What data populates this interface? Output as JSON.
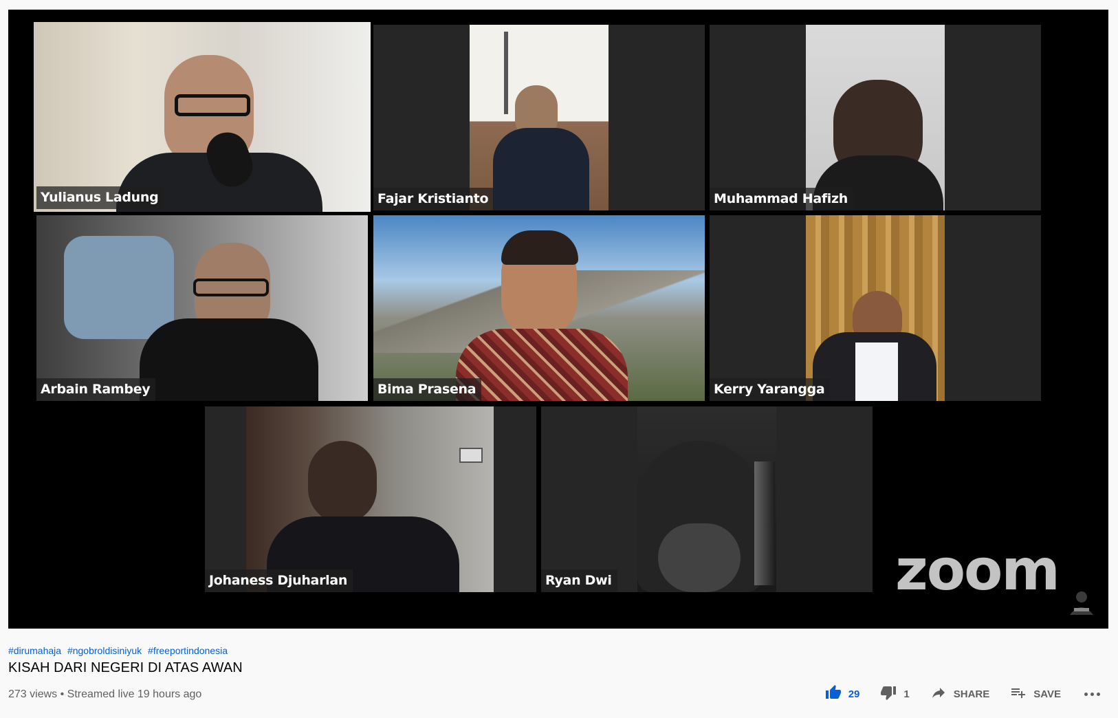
{
  "meeting": {
    "participants": [
      {
        "name": "Yulianus Ladung",
        "active": true
      },
      {
        "name": "Fajar Kristianto",
        "active": false
      },
      {
        "name": "Muhammad Hafizh",
        "active": false
      },
      {
        "name": "Arbain Rambey",
        "active": false
      },
      {
        "name": "Bima Prasena",
        "active": false
      },
      {
        "name": "Kerry Yarangga",
        "active": false
      },
      {
        "name": "Johaness Djuharlan",
        "active": false
      },
      {
        "name": "Ryan Dwi",
        "active": false
      }
    ],
    "watermark": "zoom",
    "active_speaker_color": "#7ce33a"
  },
  "video": {
    "hashtags": [
      "#dirumahaja",
      "#ngobroldisiniyuk",
      "#freeportindonesia"
    ],
    "title": "KISAH DARI NEGERI DI ATAS AWAN",
    "stats": "273 views • Streamed live 19 hours ago"
  },
  "actions": {
    "like_count": "29",
    "dislike_count": "1",
    "share_label": "SHARE",
    "save_label": "SAVE",
    "accent_color": "#065fd4"
  }
}
